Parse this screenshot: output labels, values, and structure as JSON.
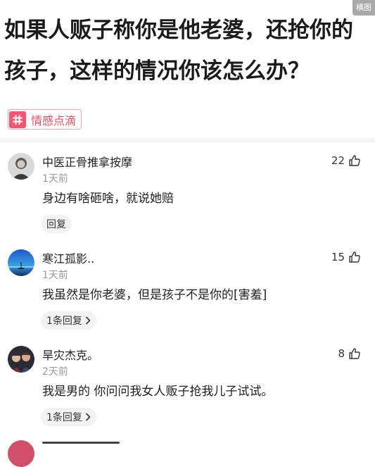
{
  "corner_tag": "横图",
  "question": "如果人贩子称你是他老婆，还抢你的孩子，这样的情况你该怎么办？",
  "topic_tag": {
    "label": "情感点滴",
    "icon": "hash-icon",
    "color": "#f2576f"
  },
  "comments": [
    {
      "author": "中医正骨推拿按摩",
      "time": "1天前",
      "text": "身边有啥砸啥，就说她赔",
      "likes": "22",
      "reply_label": "回复"
    },
    {
      "author": "寒江孤影..",
      "time": "1天前",
      "text": "我虽然是你老婆，但是孩子不是你的[害羞]",
      "likes": "15",
      "reply_label": "1条回复"
    },
    {
      "author": "旱灾杰克。",
      "time": "2天前",
      "text": "我是男的  你问问我女人贩子抢我儿子试试。",
      "likes": "8",
      "reply_label": "1条回复"
    }
  ]
}
